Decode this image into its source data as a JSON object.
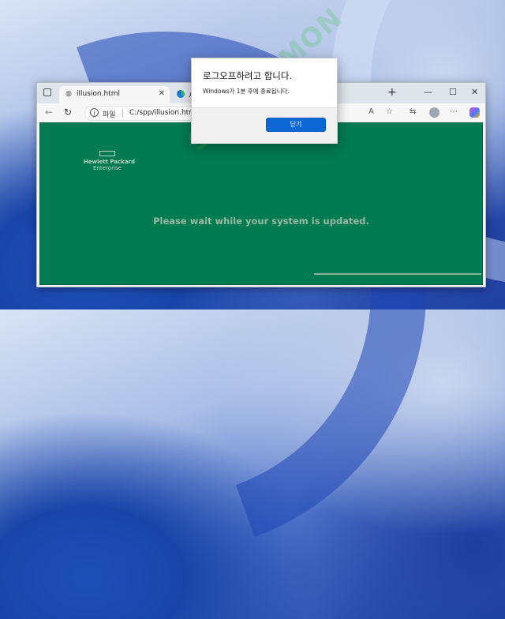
{
  "dialog": {
    "title": "로그오프하려고 합니다.",
    "message": "Windows가 1분 후에 종료됩니다.",
    "close_label": "닫기"
  },
  "browser": {
    "tabs": [
      {
        "label": "illusion.html",
        "close": "✕"
      },
      {
        "label": "새 탭",
        "close": "✕"
      }
    ],
    "new_tab": "+",
    "window_controls": {
      "minimize": "—",
      "maximize": "☐",
      "close": "✕"
    },
    "address": {
      "scheme_label": "파일",
      "url": "C:/spp/illusion.html"
    }
  },
  "page": {
    "logo_line1": "Hewlett Packard",
    "logo_line2": "Enterprise",
    "status_message": "Please wait while your system is updated.",
    "progress": 0.38,
    "background_color": "#027a52"
  },
  "watermark": "SERVERMON"
}
